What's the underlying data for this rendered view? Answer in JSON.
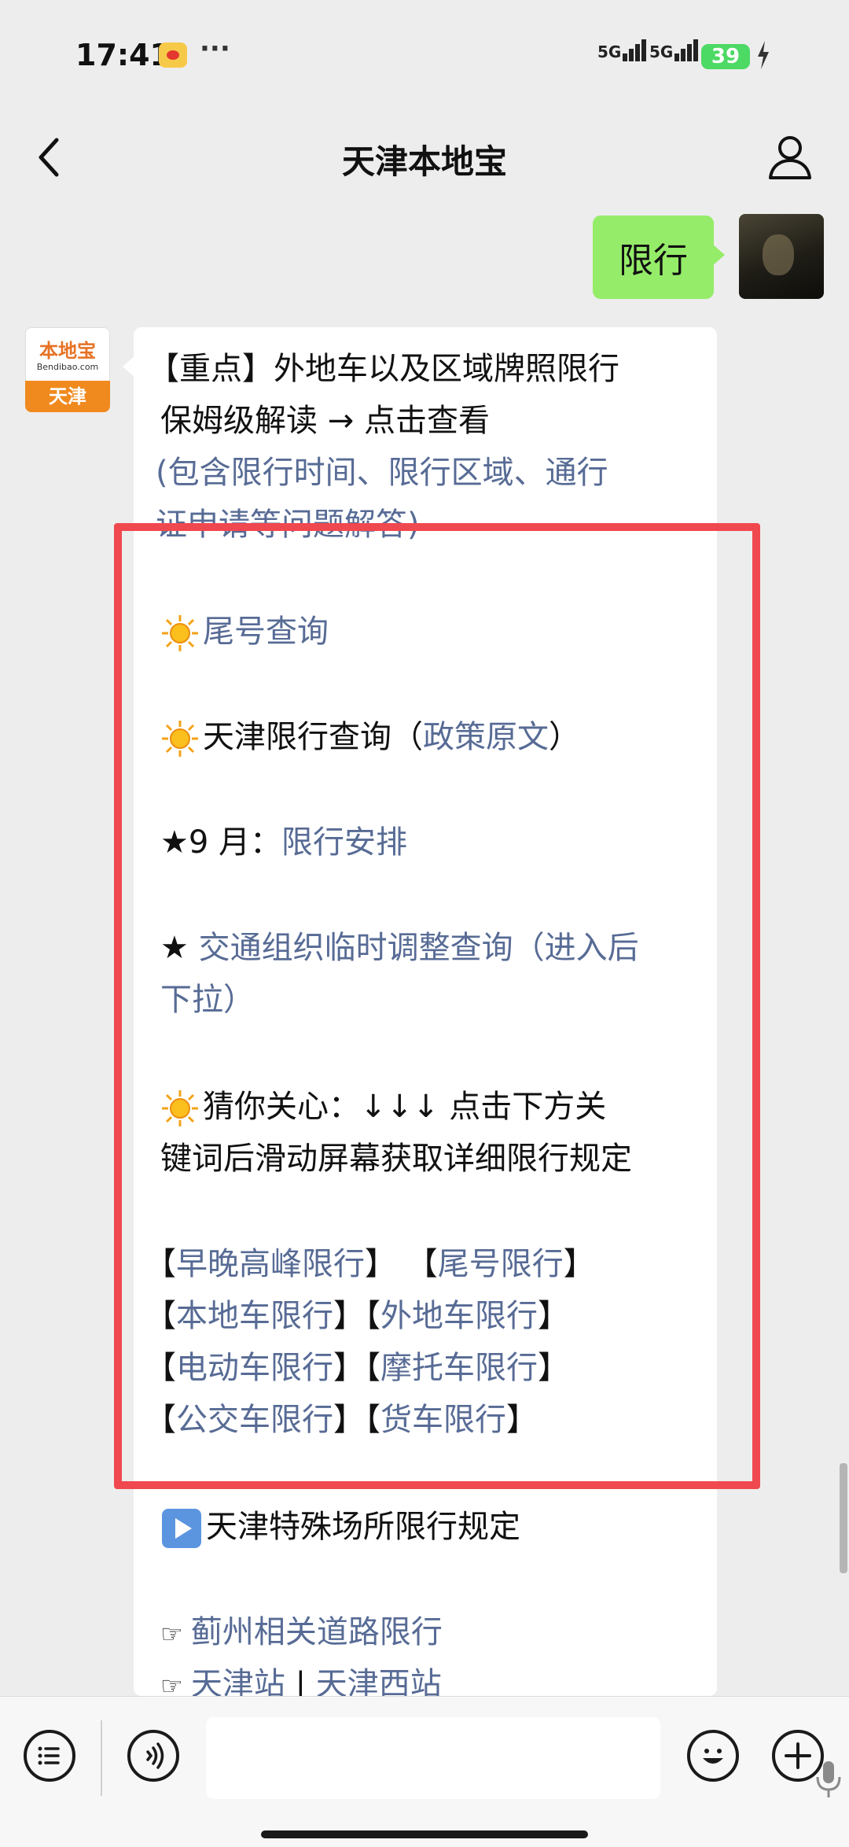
{
  "status_bar": {
    "time": "17:41",
    "more": "···",
    "signal_1": "5G",
    "signal_2": "5G",
    "battery": "39"
  },
  "nav": {
    "title": "天津本地宝",
    "back_icon": "chevron-left-icon",
    "profile_icon": "person-icon"
  },
  "sent_message": {
    "text": "限行"
  },
  "account_avatar": {
    "top_text": "本地宝",
    "url_text": "Bendibao.com",
    "bottom_text": "天津"
  },
  "message": {
    "line1": "【重点】外地车以及区域牌照限行",
    "line2": "保姆级解读 → 点击查看",
    "line3": "(包含限行时间、限行区域、通行",
    "line4": "证申请等问题解答)",
    "tail_query": "尾号查询",
    "tj_query_prefix": "天津限行查询（",
    "tj_query_link": "政策原文",
    "tj_query_suffix": "）",
    "sept_prefix": "★9 月：",
    "sept_link": "限行安排",
    "traffic_prefix": "★ ",
    "traffic_link_1": "交通组织临时调整查询（进入后",
    "traffic_link_2": "下拉）",
    "guess_line1": "猜你关心：↓↓↓ 点击下方关",
    "guess_line2": "键词后滑动屏幕获取详细限行规定",
    "keywords": [
      [
        "早晚高峰限行",
        "尾号限行"
      ],
      [
        "本地车限行",
        "外地车限行"
      ],
      [
        "电动车限行",
        "摩托车限行"
      ],
      [
        "公交车限行",
        "货车限行"
      ]
    ],
    "special_places": "天津特殊场所限行规定",
    "jizhou_link": "蓟州相关道路限行",
    "station_1": "天津站",
    "station_sep": "|",
    "station_2": "天津西站"
  },
  "bottom_bar": {
    "list_icon": "list-icon",
    "voice_icon": "voice-icon",
    "mic_icon": "microphone-icon",
    "emoji_icon": "emoji-icon",
    "add_icon": "plus-icon"
  },
  "colors": {
    "link": "#576b95",
    "sent_bubble": "#95ec69",
    "highlight": "#f0484f",
    "background": "#ededed"
  }
}
